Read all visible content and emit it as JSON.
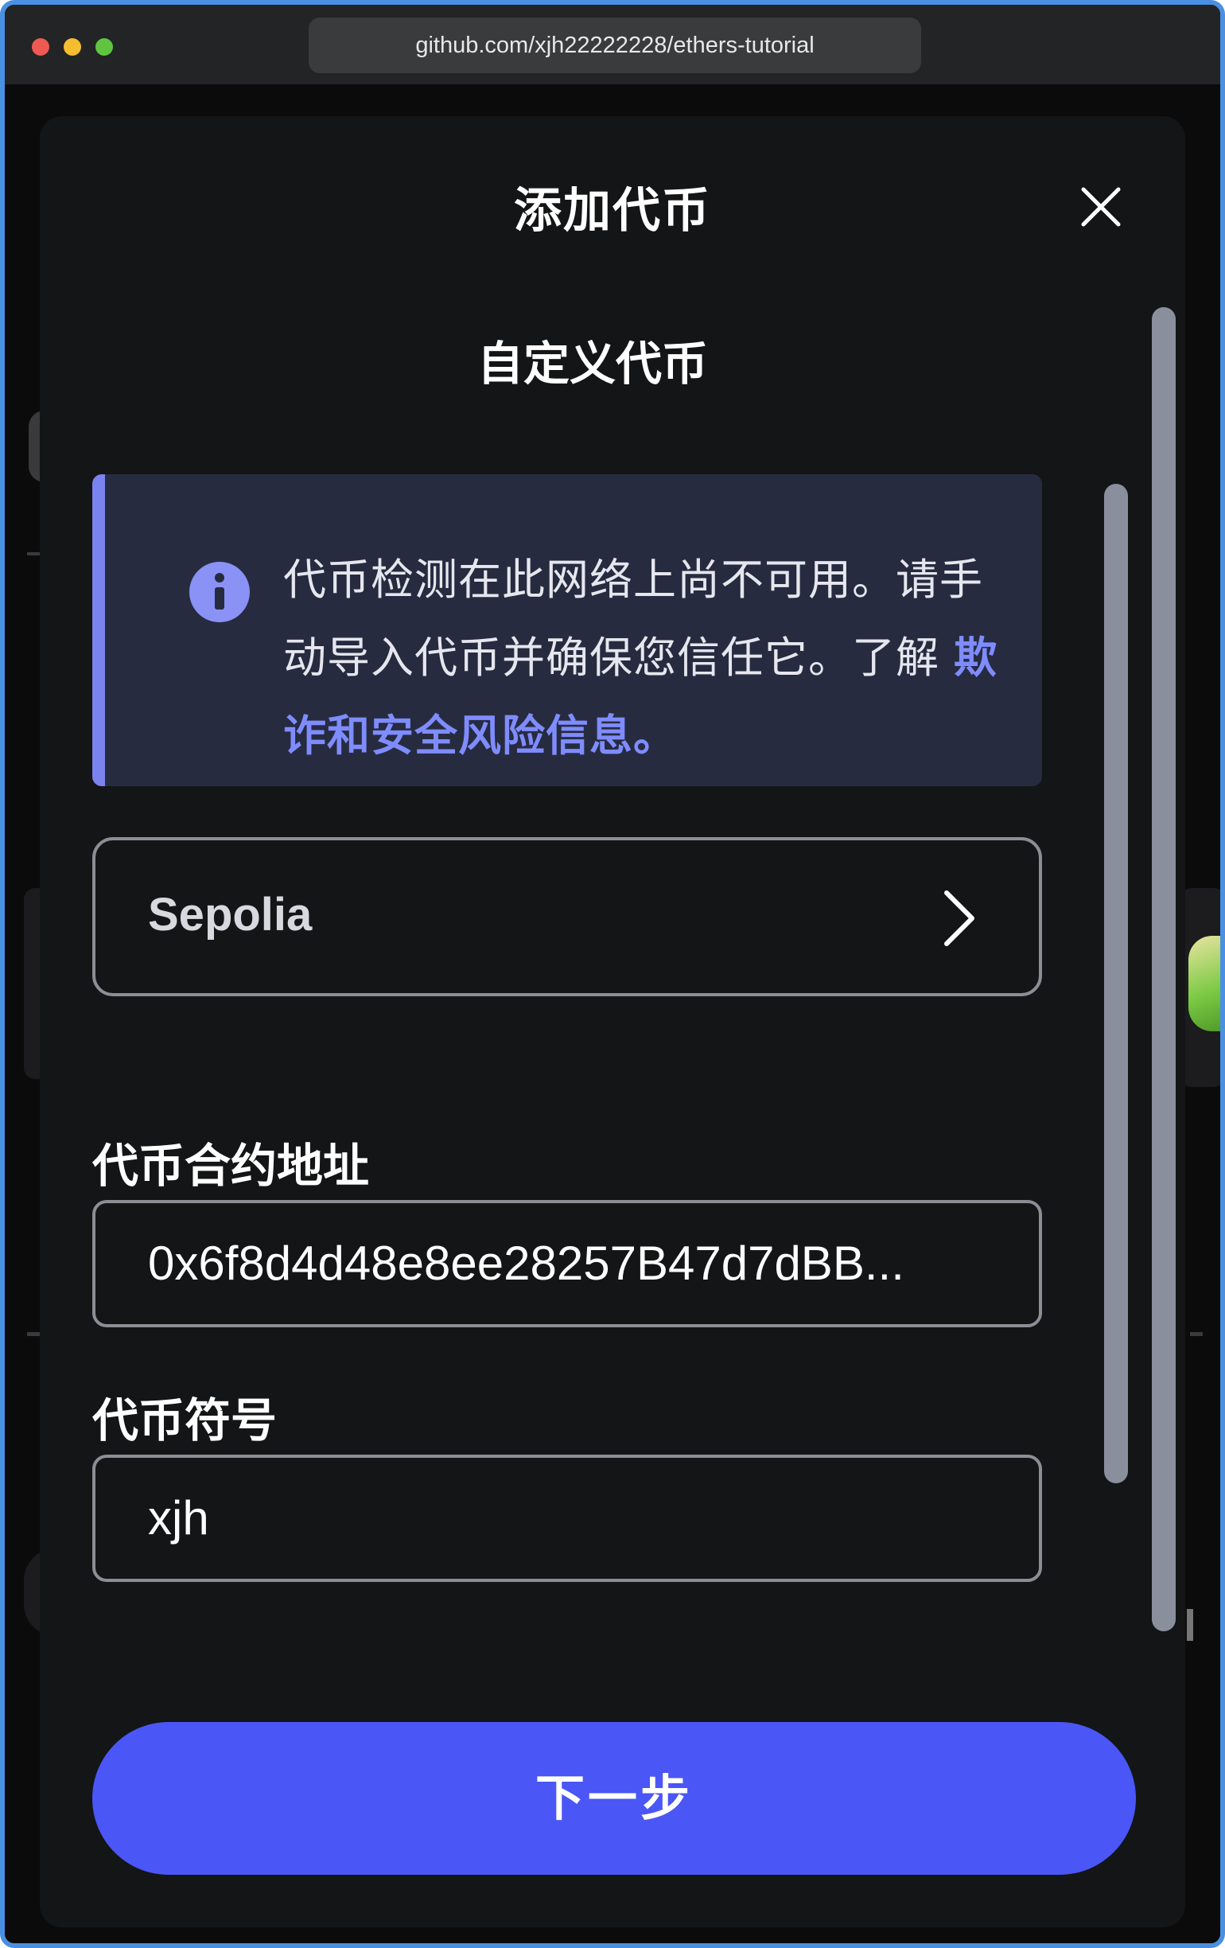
{
  "browser": {
    "url": "github.com/xjh22222228/ethers-tutorial"
  },
  "modal": {
    "title": "添加代币",
    "section_title": "自定义代币",
    "notice": {
      "text": "代币检测在此网络上尚不可用。请手动导入代币并确保您信任它。了解 ",
      "link": "欺诈和安全风险信息。"
    },
    "network": {
      "selected": "Sepolia"
    },
    "contract_address": {
      "label": "代币合约地址",
      "value": "0x6f8d4d48e8ee28257B47d7dBB..."
    },
    "token_symbol": {
      "label": "代币符号",
      "value": "xjh"
    },
    "next_button": "下一步"
  },
  "colors": {
    "accent": "#4a56f5",
    "link": "#7f8cff",
    "notice_bg": "#272b40",
    "modal_bg": "#141516"
  },
  "icons": [
    "close-icon",
    "info-icon",
    "chevron-right-icon"
  ]
}
